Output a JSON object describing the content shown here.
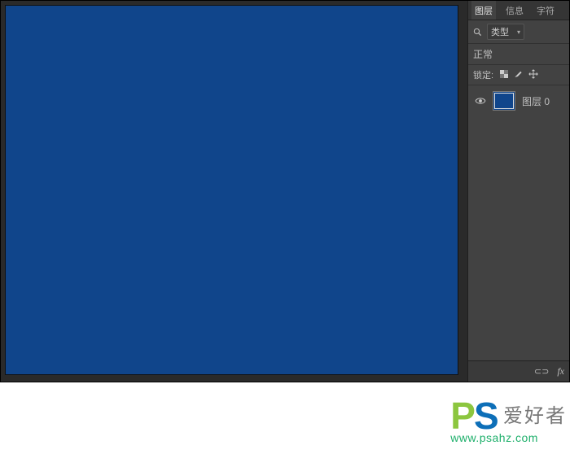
{
  "tabs": {
    "layers": "图层",
    "info": "信息",
    "chars": "字符"
  },
  "filter": {
    "icon_label": "search",
    "kind_label": "类型"
  },
  "blend_mode": "正常",
  "lock": {
    "label": "锁定:"
  },
  "layers": [
    {
      "name": "图层 0"
    }
  ],
  "footer": {
    "link": "⊂⊃",
    "fx": "fx"
  },
  "colors": {
    "canvas_fill": "#10458b"
  },
  "watermark": {
    "logo_left": "P",
    "logo_right": "S",
    "cn": "爱好者",
    "url": "www.psahz.com"
  }
}
